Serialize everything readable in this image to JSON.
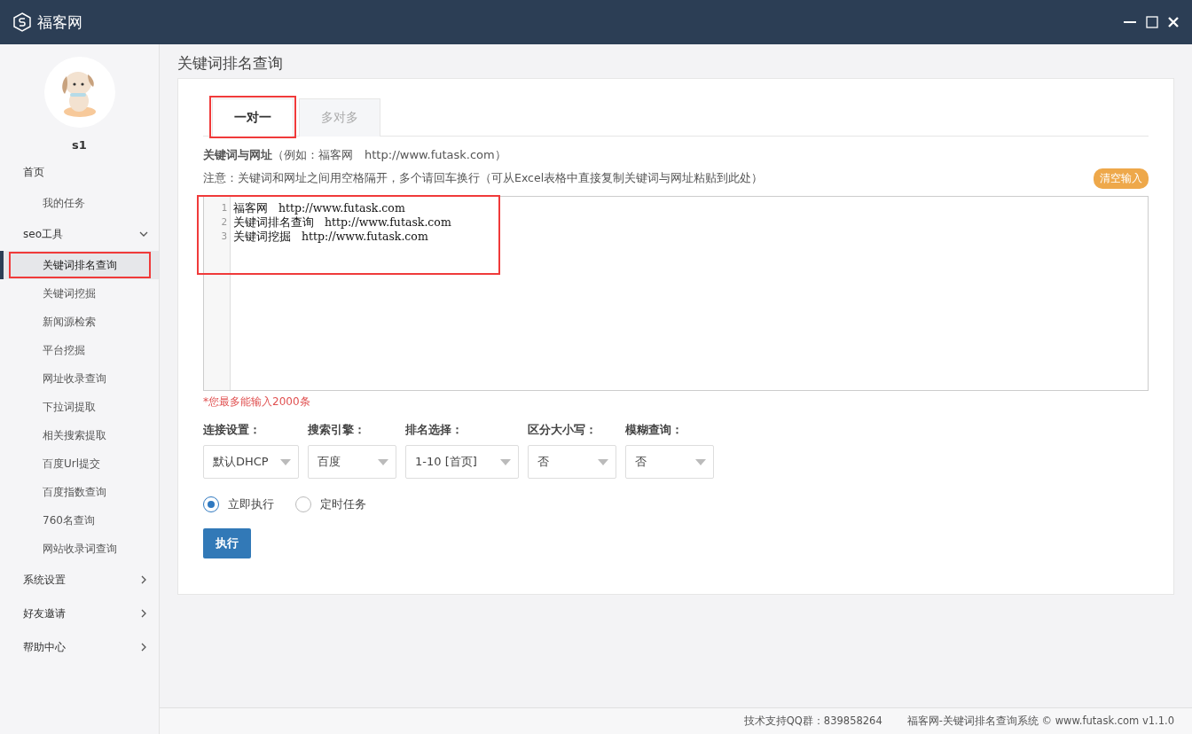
{
  "window": {
    "title": "福客网"
  },
  "sidebar": {
    "user": "s1",
    "sections": [
      {
        "label": "首页",
        "kind": "plain",
        "children": [
          {
            "label": "我的任务",
            "selected": false,
            "highlighted": false
          }
        ]
      },
      {
        "label": "seo工具",
        "kind": "group",
        "expanded": true,
        "children": [
          {
            "label": "关键词排名查询",
            "selected": true,
            "highlighted": true
          },
          {
            "label": "关键词挖掘",
            "selected": false,
            "highlighted": false
          },
          {
            "label": "新闻源检索",
            "selected": false,
            "highlighted": false
          },
          {
            "label": "平台挖掘",
            "selected": false,
            "highlighted": false
          },
          {
            "label": "网址收录查询",
            "selected": false,
            "highlighted": false
          },
          {
            "label": "下拉词提取",
            "selected": false,
            "highlighted": false
          },
          {
            "label": "相关搜索提取",
            "selected": false,
            "highlighted": false
          },
          {
            "label": "百度Url提交",
            "selected": false,
            "highlighted": false
          },
          {
            "label": "百度指数查询",
            "selected": false,
            "highlighted": false
          },
          {
            "label": "760名查询",
            "selected": false,
            "highlighted": false
          },
          {
            "label": "网站收录词查询",
            "selected": false,
            "highlighted": false
          }
        ]
      },
      {
        "label": "系统设置",
        "kind": "group",
        "expanded": false
      },
      {
        "label": "好友邀请",
        "kind": "group",
        "expanded": false
      },
      {
        "label": "帮助中心",
        "kind": "group",
        "expanded": false
      }
    ]
  },
  "page": {
    "title": "关键词排名查询",
    "tabs": [
      {
        "label": "一对一",
        "selected": true,
        "highlighted": true
      },
      {
        "label": "多对多",
        "selected": false,
        "highlighted": false
      }
    ],
    "intro": "**关键词与网址**（例如：福客网　http://www.futask.com）",
    "note": "注意：关键词和网址之间用空格隔开，多个请回车换行（可从Excel表格中直接复制关键词与网址粘贴到此处）",
    "clear_button": "清空输入",
    "editor": {
      "highlighted": true,
      "lines": [
        {
          "number": "1",
          "text": "福客网   http://www.futask.com"
        },
        {
          "number": "2",
          "text": "关键词排名查询   http://www.futask.com"
        },
        {
          "number": "3",
          "text": "关键词挖掘   http://www.futask.com"
        }
      ]
    },
    "limit_note": "*您最多能输入2000条",
    "selects": [
      {
        "label": "连接设置：",
        "value": "默认DHCP"
      },
      {
        "label": "搜索引擎：",
        "value": "百度"
      },
      {
        "label": "排名选择：",
        "value": "1-10 [首页]"
      },
      {
        "label": "区分大小写：",
        "value": "否"
      },
      {
        "label": "模糊查询：",
        "value": "否"
      }
    ],
    "run_modes": [
      {
        "label": "立即执行",
        "selected": true
      },
      {
        "label": "定时任务",
        "selected": false
      }
    ],
    "run_button": "执行"
  },
  "status_bar": {
    "support": "技术支持QQ群：839858264",
    "copyright": "福客网-关键词排名查询系统 © www.futask.com  v1.1.0"
  }
}
